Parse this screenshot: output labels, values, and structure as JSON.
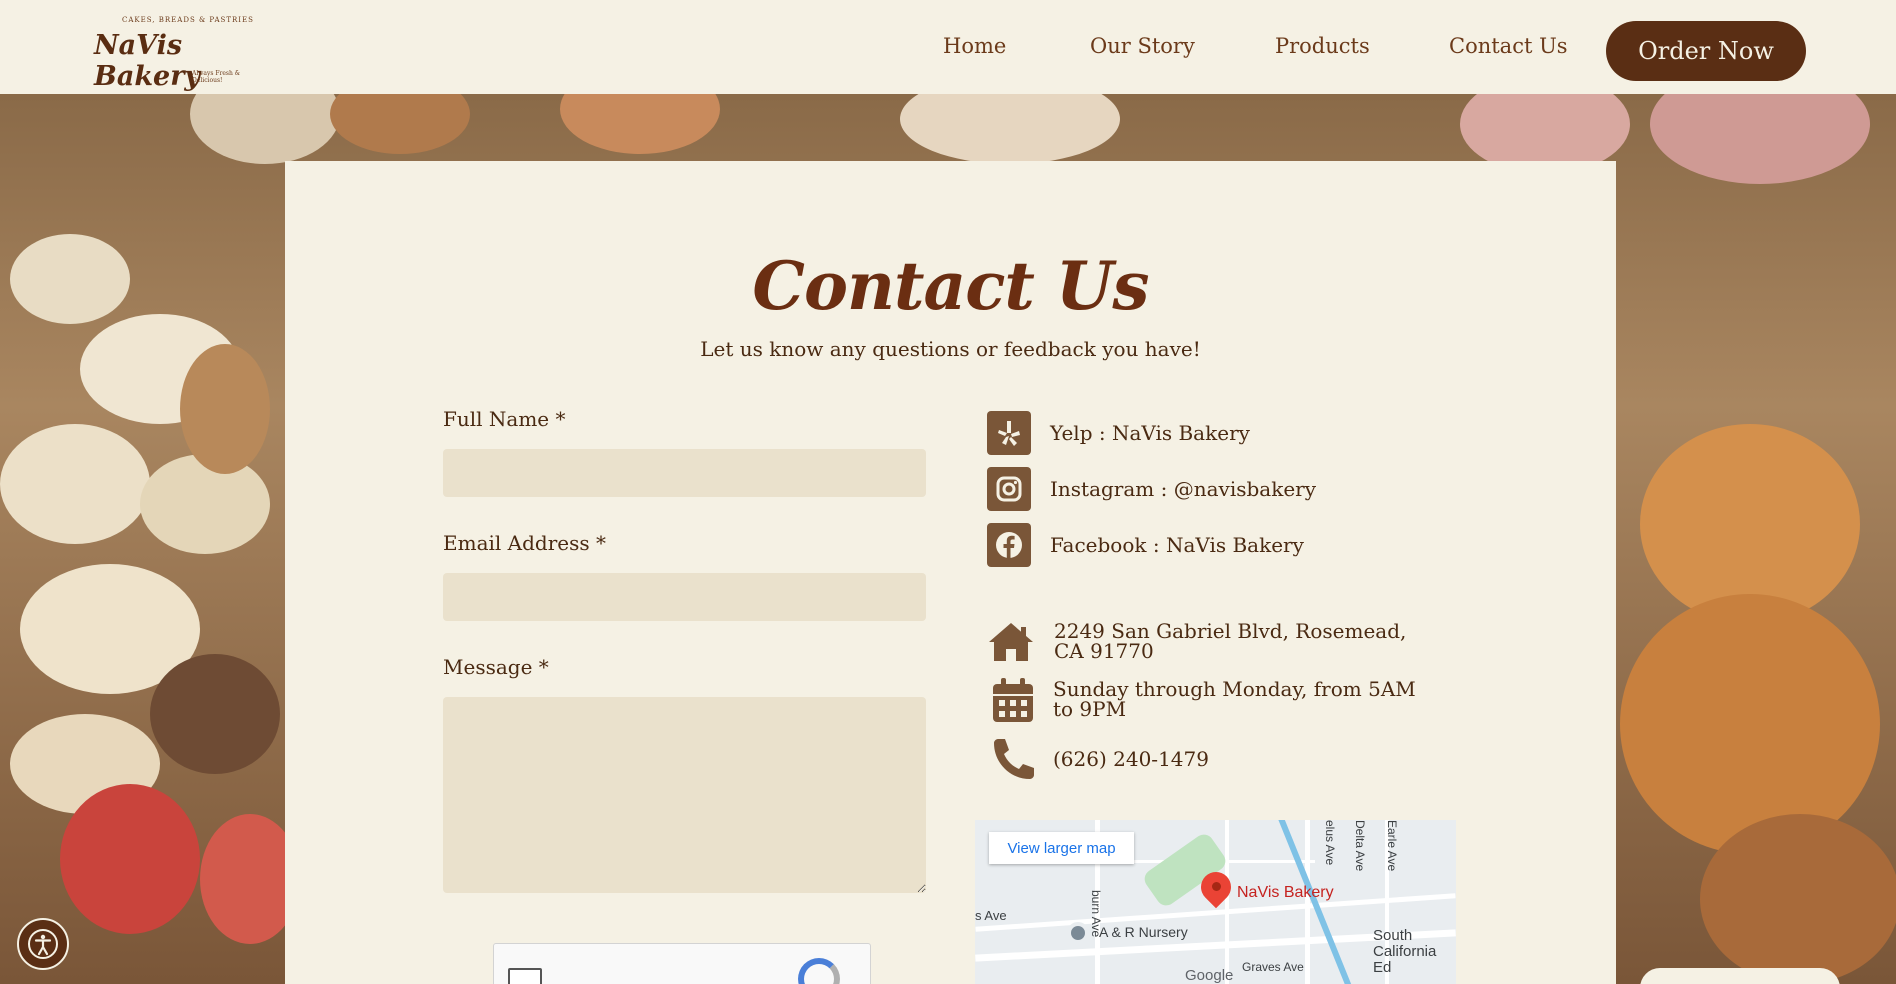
{
  "header": {
    "logo": {
      "tagline_top": "CAKES, BREADS & PASTRIES",
      "brand": "NaVis Bakery",
      "tagline_bottom": "Always Fresh & Delicious!"
    },
    "nav": [
      {
        "label": "Home"
      },
      {
        "label": "Our Story"
      },
      {
        "label": "Products"
      },
      {
        "label": "Contact Us"
      }
    ],
    "order_label": "Order Now"
  },
  "contact": {
    "title": "Contact Us",
    "subtitle": "Let us know any questions or feedback you have!",
    "form": {
      "full_name_label": "Full Name *",
      "email_label": "Email Address *",
      "message_label": "Message *",
      "full_name_value": "",
      "email_value": "",
      "message_value": ""
    },
    "social": [
      {
        "icon": "yelp-icon",
        "text": "Yelp : NaVis Bakery"
      },
      {
        "icon": "instagram-icon",
        "text": "Instagram : @navisbakery"
      },
      {
        "icon": "facebook-icon",
        "text": "Facebook : NaVis Bakery"
      }
    ],
    "address": "2249 San Gabriel Blvd, Rosemead, CA 91770",
    "hours": "Sunday through Monday, from 5AM to 9PM",
    "phone": "(626) 240-1479"
  },
  "map": {
    "button": "View larger map",
    "pin_label": "NaVis Bakery",
    "labels": [
      "A & R Nursery",
      "Graves Ave",
      "South California Ed",
      "s Ave",
      "burn Ave",
      "elus Ave",
      "Delta Ave",
      "Earle Ave"
    ],
    "google": "Google"
  },
  "colors": {
    "brand_brown": "#5a2e14",
    "cream": "#f5f1e4",
    "field": "#eae1cc",
    "icon_brown": "#7a5638"
  }
}
